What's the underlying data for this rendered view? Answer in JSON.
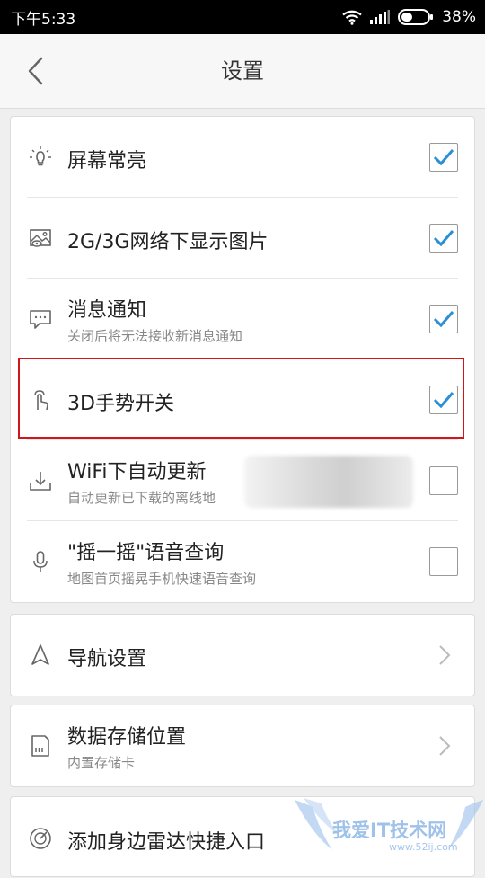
{
  "status_bar": {
    "time": "下午5:33",
    "battery": "38%"
  },
  "header": {
    "title": "设置"
  },
  "card1": {
    "rows": [
      {
        "label": "屏幕常亮",
        "sub": "",
        "checked": true,
        "icon": "bulb-icon"
      },
      {
        "label": "2G/3G网络下显示图片",
        "sub": "",
        "checked": true,
        "icon": "image-icon"
      },
      {
        "label": "消息通知",
        "sub": "关闭后将无法接收新消息通知",
        "checked": true,
        "icon": "message-icon"
      },
      {
        "label": "3D手势开关",
        "sub": "",
        "checked": true,
        "icon": "gesture-icon"
      },
      {
        "label": "WiFi下自动更新",
        "sub": "自动更新已下载的离线地",
        "checked": false,
        "icon": "download-icon"
      },
      {
        "label": "\"摇一摇\"语音查询",
        "sub": "地图首页摇晃手机快速语音查询",
        "checked": false,
        "icon": "microphone-icon"
      }
    ]
  },
  "card2": {
    "label": "导航设置"
  },
  "card3": {
    "label": "数据存储位置",
    "sub": "内置存储卡"
  },
  "card4": {
    "label": "添加身边雷达快捷入口"
  },
  "watermark": {
    "text": "我爱IT技术网",
    "url": "www.52ij.com"
  },
  "colors": {
    "check": "#2b8fd6",
    "highlight": "#d0161b",
    "icon": "#666666"
  }
}
